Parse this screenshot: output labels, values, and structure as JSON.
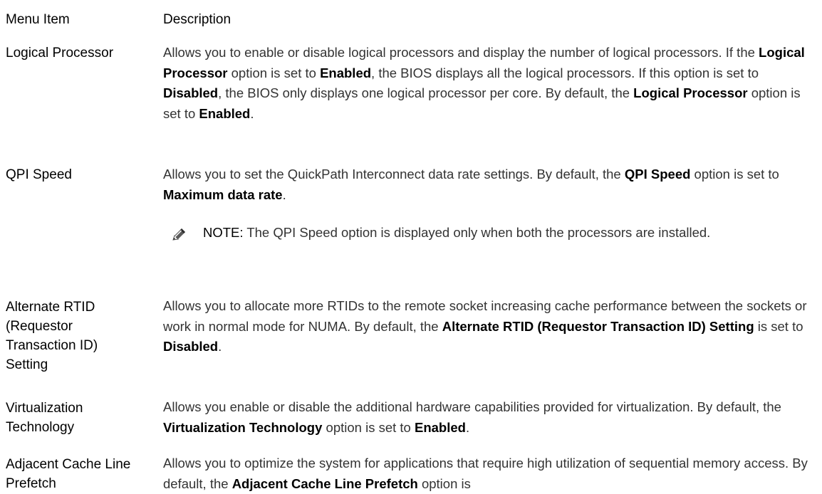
{
  "table": {
    "header": {
      "menu_item": "Menu Item",
      "description": "Description"
    },
    "rows": [
      {
        "item": "Logical Processor",
        "description": {
          "t1": "Allows you to enable or disable logical processors and display the number of logical processors. If the ",
          "b1": "Logical Processor",
          "t2": " option is set to ",
          "b2": "Enabled",
          "t3": ", the BIOS displays all the logical processors. If this option is set to ",
          "b3": "Disabled",
          "t4": ", the BIOS only displays one logical processor per core. By default, the ",
          "b4": "Logical Processor",
          "t5": " option is set to ",
          "b5": "Enabled",
          "t6": "."
        }
      },
      {
        "item": "QPI Speed",
        "description": {
          "t1": "Allows you to set the QuickPath Interconnect data rate settings. By default, the ",
          "b1": "QPI Speed",
          "t2": " option is set to ",
          "b2": "Maximum data rate",
          "t3": "."
        },
        "note": {
          "label": "NOTE:",
          "text": " The QPI Speed option is displayed only when both the processors are installed."
        }
      },
      {
        "item": "Alternate RTID (Requestor Transaction ID) Setting",
        "description": {
          "t1": "Allows you to allocate more RTIDs to the remote socket increasing cache performance between the sockets or work in normal mode for NUMA. By default, the ",
          "b1": "Alternate RTID (Requestor Transaction ID) Setting",
          "t2": " is set to ",
          "b2": "Disabled",
          "t3": "."
        }
      },
      {
        "item": "Virtualization Technology",
        "description": {
          "t1": "Allows you enable or disable the additional hardware capabilities provided for virtualization. By default, the ",
          "b1": "Virtualization Technology",
          "t2": " option is set to ",
          "b2": "Enabled",
          "t3": "."
        }
      },
      {
        "item": "Adjacent Cache Line Prefetch",
        "description": {
          "t1": "Allows you to optimize the system for applications that require high utilization of sequential memory access. By default, the ",
          "b1": "Adjacent Cache Line Prefetch",
          "t2": " option is"
        }
      }
    ]
  }
}
